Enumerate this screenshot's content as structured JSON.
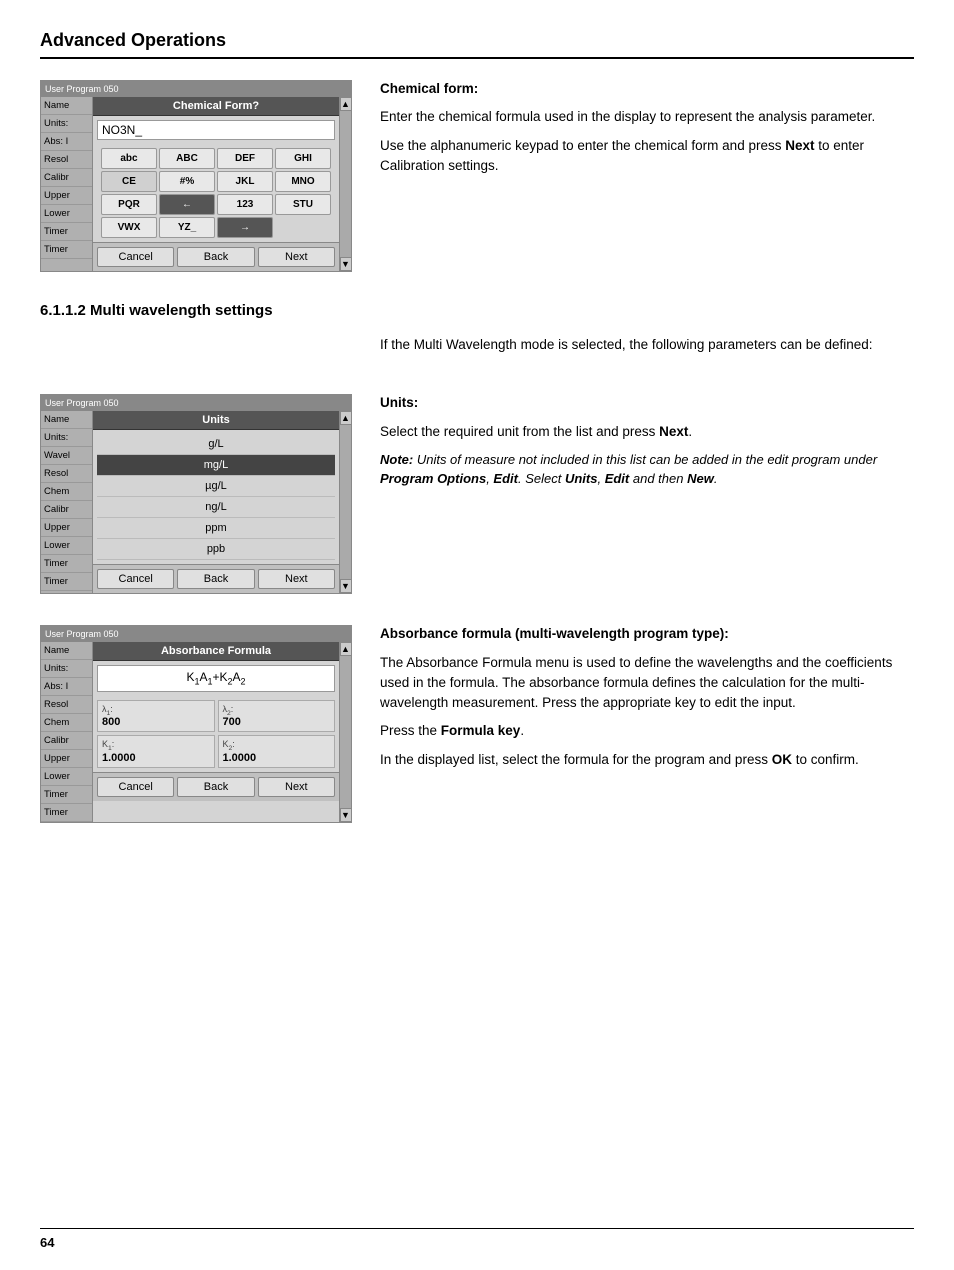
{
  "page": {
    "header": "Advanced Operations",
    "footer_page": "64"
  },
  "section1": {
    "subsection": "",
    "screen": {
      "top_bar": "User Program  050",
      "dialog_title": "Chemical Form?",
      "input_value": "NO3N_",
      "sidebar_items": [
        "Name",
        "Units:",
        "Abs: I",
        "Resol",
        "Calibr",
        "Upper",
        "Lower",
        "Timer",
        "Timer"
      ],
      "keys_row1": [
        "abc",
        "ABC",
        "DEF",
        "GHI",
        "CE"
      ],
      "keys_row2": [
        "#%",
        "JKL",
        "MNO",
        "PQR",
        "←"
      ],
      "keys_row3": [
        "123",
        "STU",
        "VWX",
        "YZ_",
        "→"
      ],
      "btn_cancel": "Cancel",
      "btn_back": "Back",
      "btn_next": "Next"
    },
    "title": "Chemical form:",
    "body1": "Enter the chemical formula used in the display to represent the analysis parameter.",
    "body2": "Use the alphanumeric keypad to enter the chemical form and press Next to enter Calibration settings."
  },
  "section2": {
    "subsection": "6.1.1.2   Multi wavelength settings",
    "intro": "If the Multi Wavelength mode is selected, the following parameters can be defined:",
    "screen": {
      "top_bar": "User Program  050",
      "dialog_title": "Units",
      "sidebar_items": [
        "Name",
        "Units:",
        "Wavel",
        "Resol",
        "Chem",
        "Calibr",
        "Upper",
        "Lower",
        "Timer",
        "Timer"
      ],
      "units_list": [
        "g/L",
        "mg/L",
        "µg/L",
        "ng/L",
        "ppm",
        "ppb"
      ],
      "selected_index": 1,
      "btn_cancel": "Cancel",
      "btn_back": "Back",
      "btn_next": "Next"
    },
    "title": "Units:",
    "body1": "Select the required unit from the list and press Next.",
    "note": "Note: Units of measure not included in this list can be added in the edit program under Program Options, Edit. Select Units, Edit and then New."
  },
  "section3": {
    "screen": {
      "top_bar": "User Program  050",
      "dialog_title": "Absorbance Formula",
      "sidebar_items": [
        "Name",
        "Units:",
        "Abs: I",
        "Resol",
        "Chem",
        "Calibr",
        "Upper",
        "Lower",
        "Timer",
        "Timer"
      ],
      "formula": "K₁A₁+K₂A₂",
      "lambda1_label": "λ₁:",
      "lambda1_val": "800",
      "lambda2_label": "λ₂:",
      "lambda2_val": "700",
      "k1_label": "K₁:",
      "k1_val": "1.0000",
      "k2_label": "K₂:",
      "k2_val": "1.0000",
      "btn_cancel": "Cancel",
      "btn_back": "Back",
      "btn_next": "Next"
    },
    "title": "Absorbance formula (multi-wavelength program type):",
    "body1": "The Absorbance Formula menu is used to define the wavelengths and the coefficients used in the formula. The absorbance formula defines the calculation for the multi-wavelength measurement. Press the appropriate key to edit the input.",
    "body2": "Press the Formula key.",
    "body3": "In the displayed list, select the formula for the program and press OK to confirm."
  }
}
